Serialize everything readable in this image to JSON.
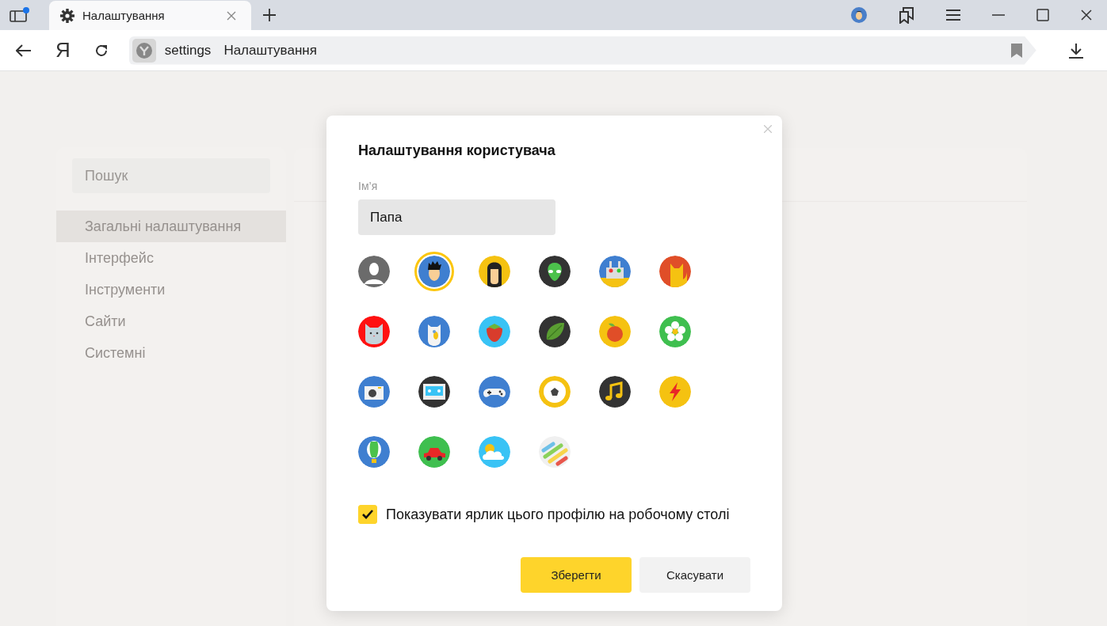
{
  "tabs": [
    {
      "title": "Налаштування",
      "selected": true
    }
  ],
  "toolbar": {
    "logo": "Я",
    "address_scheme": "settings",
    "address_title": "Налаштування"
  },
  "sidebar": {
    "search": {
      "placeholder": "Пошук"
    },
    "items": [
      {
        "label": "Загальні налаштування",
        "selected": true
      },
      {
        "label": "Інтерфейс",
        "selected": false
      },
      {
        "label": "Інструменти",
        "selected": false
      },
      {
        "label": "Сайти",
        "selected": false
      },
      {
        "label": "Системні",
        "selected": false
      }
    ]
  },
  "dialog": {
    "title": "Налаштування користувача",
    "name_label": "Ім’я",
    "name_value": "Папа",
    "avatars": [
      {
        "kind": "person",
        "selected": false
      },
      {
        "kind": "boy",
        "selected": true
      },
      {
        "kind": "girl",
        "selected": false
      },
      {
        "kind": "alien",
        "selected": false
      },
      {
        "kind": "robot",
        "selected": false
      },
      {
        "kind": "cat",
        "selected": false
      },
      {
        "kind": "kitten",
        "selected": false
      },
      {
        "kind": "dog",
        "selected": false
      },
      {
        "kind": "strawberry",
        "selected": false
      },
      {
        "kind": "leaf",
        "selected": false
      },
      {
        "kind": "apple",
        "selected": false
      },
      {
        "kind": "flower",
        "selected": false
      },
      {
        "kind": "camera",
        "selected": false
      },
      {
        "kind": "cassette",
        "selected": false
      },
      {
        "kind": "gamepad",
        "selected": false
      },
      {
        "kind": "ball",
        "selected": false
      },
      {
        "kind": "music",
        "selected": false
      },
      {
        "kind": "lightning",
        "selected": false
      },
      {
        "kind": "balloon",
        "selected": false
      },
      {
        "kind": "car",
        "selected": false
      },
      {
        "kind": "cloud",
        "selected": false
      },
      {
        "kind": "stripes",
        "selected": false
      }
    ],
    "shortcut": {
      "label": "Показувати ярлик цього профілю на робочому столі",
      "checked": true
    },
    "buttons": [
      {
        "label": "Зберегти",
        "kind": "primary"
      },
      {
        "label": "Скасувати",
        "kind": "secondary"
      }
    ]
  }
}
